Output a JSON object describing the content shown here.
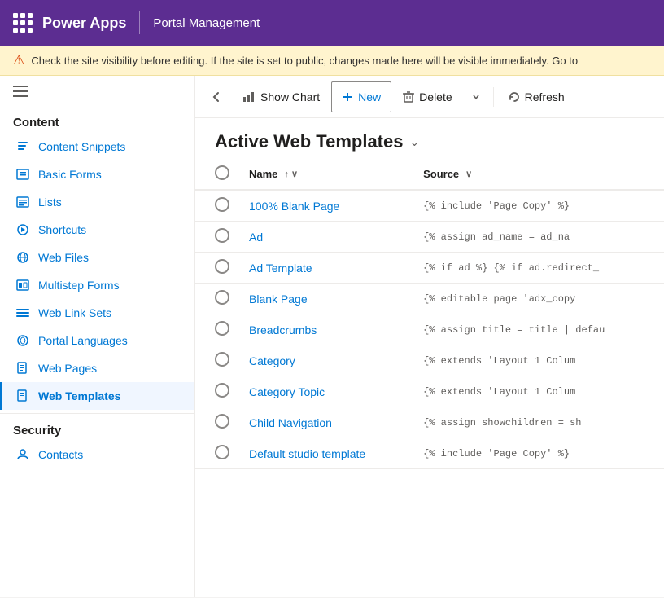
{
  "topbar": {
    "app_name": "Power Apps",
    "app_subtitle": "Portal Management"
  },
  "warning": {
    "icon": "⚠",
    "text": "Check the site visibility before editing. If the site is set to public, changes made here will be visible immediately. Go to"
  },
  "toolbar": {
    "back_icon": "←",
    "show_chart_label": "Show Chart",
    "new_label": "New",
    "delete_label": "Delete",
    "refresh_label": "Refresh"
  },
  "page_title": "Active Web Templates",
  "columns": {
    "name_label": "Name",
    "source_label": "Source"
  },
  "rows": [
    {
      "name": "100% Blank Page",
      "source": "{% include 'Page Copy' %}"
    },
    {
      "name": "Ad",
      "source": "{% assign ad_name = ad_na"
    },
    {
      "name": "Ad Template",
      "source": "{% if ad %} {% if ad.redirect_"
    },
    {
      "name": "Blank Page",
      "source": "{% editable page 'adx_copy"
    },
    {
      "name": "Breadcrumbs",
      "source": "{% assign title = title | defau"
    },
    {
      "name": "Category",
      "source": "{% extends 'Layout 1 Colum"
    },
    {
      "name": "Category Topic",
      "source": "{% extends 'Layout 1 Colum"
    },
    {
      "name": "Child Navigation",
      "source": "{% assign showchildren = sh"
    },
    {
      "name": "Default studio template",
      "source": "{% include 'Page Copy' %}"
    }
  ],
  "sidebar": {
    "content_section": "Content",
    "items": [
      {
        "id": "content-snippets",
        "label": "Content Snippets",
        "icon": "📄"
      },
      {
        "id": "basic-forms",
        "label": "Basic Forms",
        "icon": "📋"
      },
      {
        "id": "lists",
        "label": "Lists",
        "icon": "📊"
      },
      {
        "id": "shortcuts",
        "label": "Shortcuts",
        "icon": "🔗"
      },
      {
        "id": "web-files",
        "label": "Web Files",
        "icon": "🌐"
      },
      {
        "id": "multistep-forms",
        "label": "Multistep Forms",
        "icon": "📝"
      },
      {
        "id": "web-link-sets",
        "label": "Web Link Sets",
        "icon": "☰"
      },
      {
        "id": "portal-languages",
        "label": "Portal Languages",
        "icon": "🌍"
      },
      {
        "id": "web-pages",
        "label": "Web Pages",
        "icon": "📄"
      },
      {
        "id": "web-templates",
        "label": "Web Templates",
        "icon": "📄"
      }
    ],
    "security_section": "Security",
    "security_items": [
      {
        "id": "contacts",
        "label": "Contacts",
        "icon": "👤"
      }
    ]
  }
}
